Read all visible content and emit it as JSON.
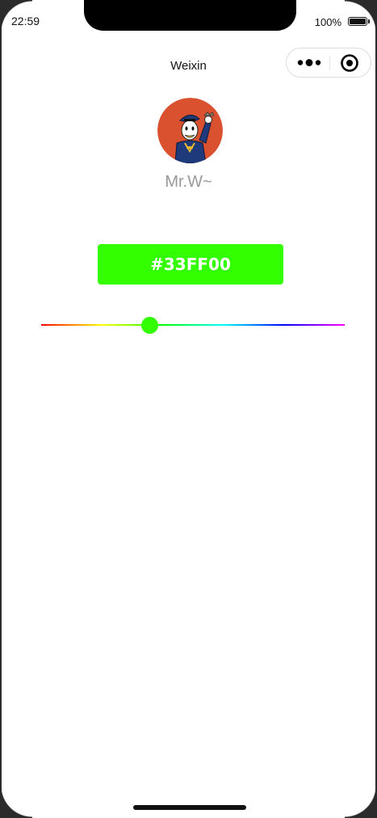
{
  "status_bar": {
    "time": "22:59",
    "battery_percent": "100%",
    "battery_level": 1.0
  },
  "nav": {
    "title": "Weixin",
    "more_icon": "more-dots-icon",
    "close_icon": "target-circle-icon"
  },
  "profile": {
    "avatar_icon": "donald-duck-avatar",
    "username": "Mr.W~"
  },
  "color_button": {
    "label": "#33FF00",
    "background": "#33FF00"
  },
  "slider": {
    "value_fraction": 0.357,
    "thumb_color": "#33FF00",
    "gradient": [
      "#ff0000",
      "#ffff00",
      "#00ff00",
      "#00ffff",
      "#0000ff",
      "#ff00ff"
    ]
  },
  "colors": {
    "avatar_bg": "#D9512F",
    "username_text": "#999999"
  }
}
